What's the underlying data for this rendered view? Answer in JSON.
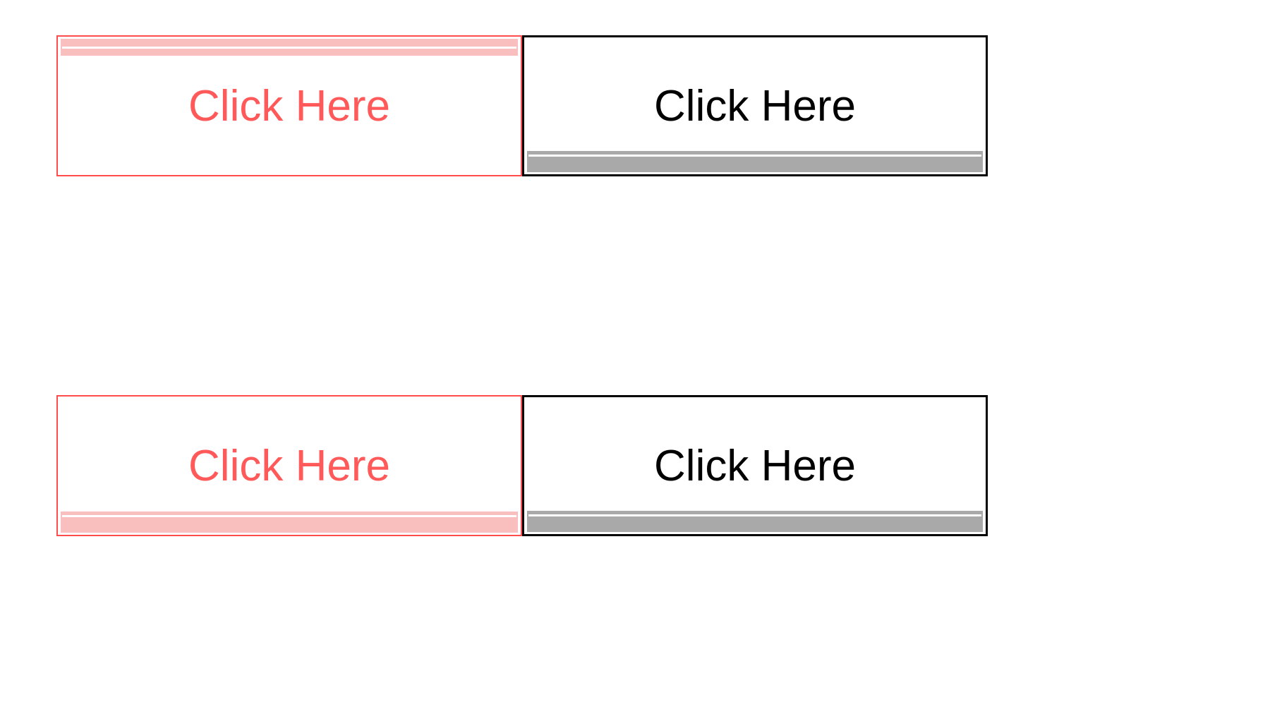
{
  "colors": {
    "red_border": "#ff4d4d",
    "red_text": "#ff5959",
    "red_accent": "#f9bfbf",
    "black_border": "#000000",
    "black_text": "#000000",
    "gray_accent": "#a9a9a9"
  },
  "rows": [
    {
      "left": {
        "label": "Click Here",
        "variant": "red",
        "accent_position": "top"
      },
      "right": {
        "label": "Click Here",
        "variant": "black",
        "accent_position": "bottom"
      }
    },
    {
      "left": {
        "label": "Click Here",
        "variant": "red",
        "accent_position": "bottom"
      },
      "right": {
        "label": "Click Here",
        "variant": "black",
        "accent_position": "bottom"
      }
    }
  ]
}
